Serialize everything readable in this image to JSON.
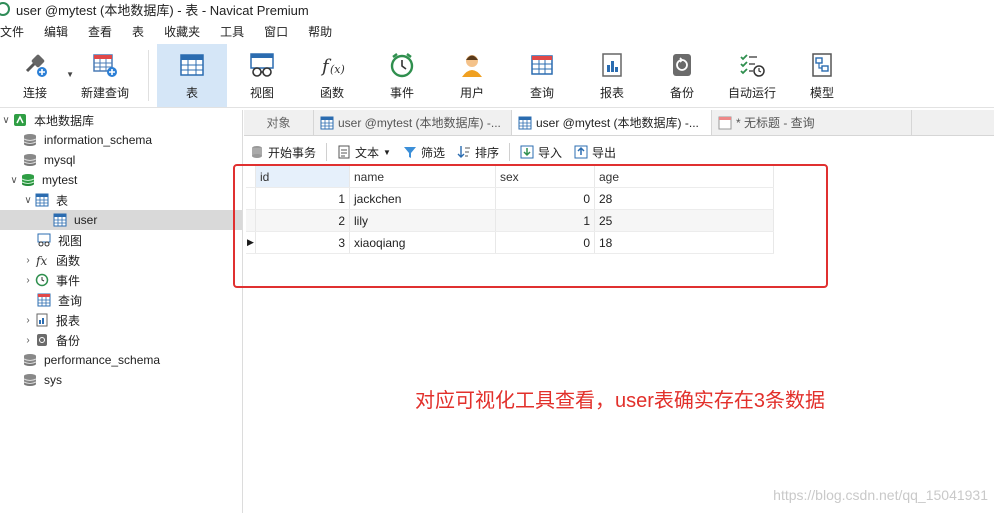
{
  "window": {
    "title": "user @mytest (本地数据库) - 表 - Navicat Premium"
  },
  "menu": [
    "文件",
    "编辑",
    "查看",
    "表",
    "收藏夹",
    "工具",
    "窗口",
    "帮助"
  ],
  "toolbar": {
    "connect": "连接",
    "new_query": "新建查询",
    "table": "表",
    "view": "视图",
    "function": "函数",
    "event": "事件",
    "user": "用户",
    "query": "查询",
    "report": "报表",
    "backup": "备份",
    "automation": "自动运行",
    "model": "模型"
  },
  "sidebar": {
    "connection": "本地数据库",
    "db_information_schema": "information_schema",
    "db_mysql": "mysql",
    "db_mytest": "mytest",
    "group_tables": "表",
    "table_user": "user",
    "group_views": "视图",
    "group_functions": "函数",
    "group_events": "事件",
    "group_queries": "查询",
    "group_reports": "报表",
    "group_backups": "备份",
    "db_performance_schema": "performance_schema",
    "db_sys": "sys"
  },
  "tabs": {
    "objects": "对象",
    "tab1": "user @mytest (本地数据库) -...",
    "tab2": "user @mytest (本地数据库) -...",
    "tab3": "* 无标题 - 查询"
  },
  "subtoolbar": {
    "begin_tx": "开始事务",
    "text": "文本",
    "filter": "筛选",
    "sort": "排序",
    "import": "导入",
    "export": "导出"
  },
  "grid": {
    "columns": [
      "id",
      "name",
      "sex",
      "age"
    ],
    "rows": [
      {
        "id": "1",
        "name": "jackchen",
        "sex": "0",
        "age": "28"
      },
      {
        "id": "2",
        "name": "lily",
        "sex": "1",
        "age": "25"
      },
      {
        "id": "3",
        "name": "xiaoqiang",
        "sex": "0",
        "age": "18"
      }
    ]
  },
  "annotation": "对应可视化工具查看，user表确实存在3条数据",
  "watermark": "https://blog.csdn.net/qq_15041931",
  "colors": {
    "accent": "#d5e6f7",
    "annotation_red": "#e2302b"
  }
}
